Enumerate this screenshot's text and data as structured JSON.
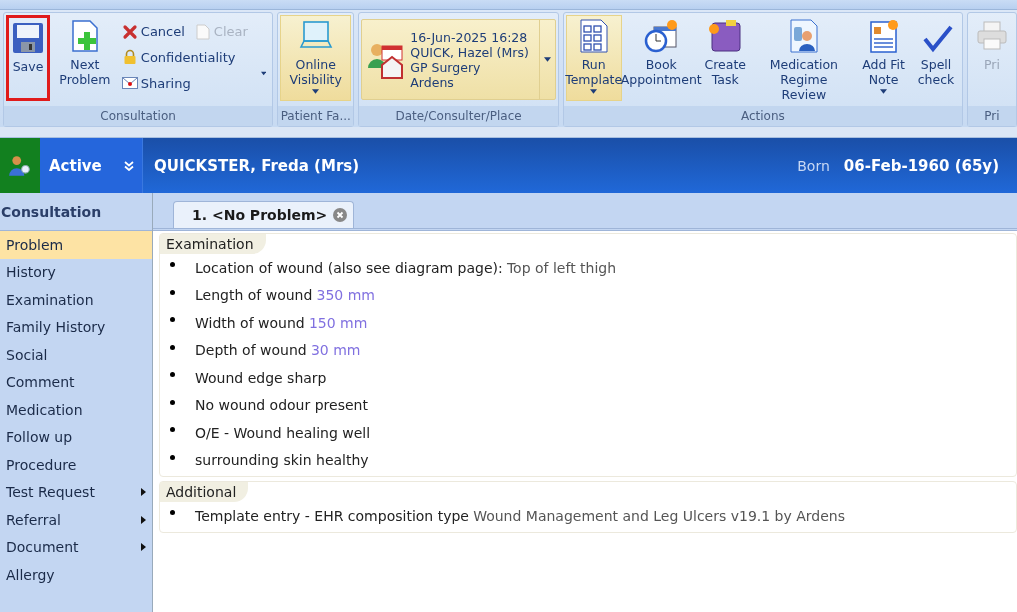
{
  "ribbon": {
    "groups": [
      {
        "kind": "consultation",
        "label": "Consultation",
        "large": [
          {
            "label": "Save",
            "kind": "save",
            "highlighted": true
          },
          {
            "label": "Next Problem",
            "kind": "next",
            "highlighted": false
          }
        ],
        "small": [
          {
            "label": "Cancel",
            "kind": "cancel",
            "disabled": false
          },
          {
            "label": "Clear",
            "kind": "clear",
            "disabled": true
          },
          {
            "label": "Confidentiality",
            "kind": "lock",
            "disabled": false
          },
          {
            "label": "Sharing",
            "kind": "envelope",
            "disabled": false
          }
        ]
      },
      {
        "kind": "large",
        "label": "Patient Fa...",
        "buttons": [
          {
            "label": "Online Visibility",
            "kind": "monitor",
            "dropdown": true,
            "selected": true
          }
        ]
      },
      {
        "kind": "place",
        "label": "Date/Consulter/Place",
        "lines": [
          "16-Jun-2025 16:28",
          "QUICK, Hazel (Mrs)",
          "GP Surgery",
          "Ardens"
        ]
      },
      {
        "kind": "large",
        "label": "Actions",
        "buttons": [
          {
            "label": "Run Template",
            "kind": "template",
            "dropdown": true,
            "selected": true
          },
          {
            "label": "Book Appointment",
            "kind": "appointment",
            "dropdown": false,
            "selected": false
          },
          {
            "label": "Create Task",
            "kind": "task",
            "dropdown": false,
            "selected": false
          },
          {
            "label": "Medication Regime Review",
            "kind": "review",
            "dropdown": false,
            "selected": false
          },
          {
            "label": "Add Fit Note",
            "kind": "note",
            "dropdown": true,
            "selected": false
          },
          {
            "label": "Spell check",
            "kind": "spell",
            "dropdown": false,
            "selected": false
          }
        ]
      },
      {
        "kind": "large",
        "label": "Pri",
        "buttons": [
          {
            "label": "Pri",
            "kind": "printer",
            "dropdown": false,
            "selected": false,
            "disabled": true
          }
        ]
      }
    ]
  },
  "patient_bar": {
    "status": "Active",
    "name": "QUICKSTER,  Freda (Mrs)",
    "born_label": "Born",
    "born_value": "06-Feb-1960 (65y)"
  },
  "sidebar": {
    "title": "Consultation",
    "items": [
      {
        "label": "Problem",
        "selected": true,
        "submenu": false
      },
      {
        "label": "History",
        "selected": false,
        "submenu": false
      },
      {
        "label": "Examination",
        "selected": false,
        "submenu": false
      },
      {
        "label": "Family History",
        "selected": false,
        "submenu": false
      },
      {
        "label": "Social",
        "selected": false,
        "submenu": false
      },
      {
        "label": "Comment",
        "selected": false,
        "submenu": false
      },
      {
        "label": "Medication",
        "selected": false,
        "submenu": false
      },
      {
        "label": "Follow up",
        "selected": false,
        "submenu": false
      },
      {
        "label": "Procedure",
        "selected": false,
        "submenu": false
      },
      {
        "label": "Test Request",
        "selected": false,
        "submenu": true
      },
      {
        "label": "Referral",
        "selected": false,
        "submenu": true
      },
      {
        "label": "Document",
        "selected": false,
        "submenu": true
      },
      {
        "label": "Allergy",
        "selected": false,
        "submenu": false
      }
    ]
  },
  "tabs": [
    {
      "label": "1. <No Problem>",
      "selected": true
    }
  ],
  "sections": [
    {
      "heading": "Examination",
      "entries": [
        {
          "text": "Location of wound (also see diagram page):",
          "term": "Top of left thigh"
        },
        {
          "text": "Length of wound",
          "result": "350 mm"
        },
        {
          "text": "Width of wound",
          "result": "150 mm"
        },
        {
          "text": "Depth of wound",
          "result": "30 mm"
        },
        {
          "text": "Wound edge sharp"
        },
        {
          "text": "No wound odour present"
        },
        {
          "text": "O/E - Wound healing well"
        },
        {
          "text": "surrounding skin healthy"
        }
      ]
    },
    {
      "heading": "Additional",
      "entries": [
        {
          "text": "Template entry - EHR composition type",
          "term": "Wound Management and Leg Ulcers v19.1 by Ardens"
        }
      ]
    }
  ]
}
